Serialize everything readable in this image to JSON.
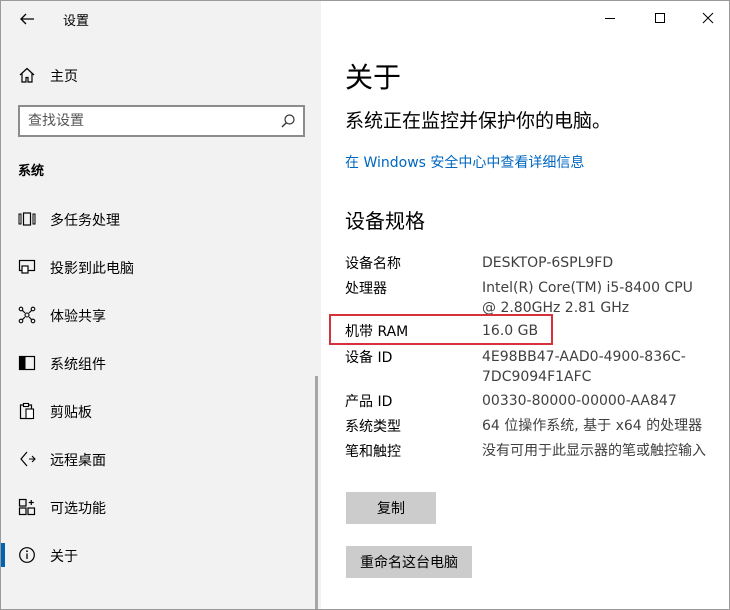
{
  "window": {
    "title": "设置"
  },
  "sidebar": {
    "home_label": "主页",
    "search_placeholder": "查找设置",
    "section_label": "系统",
    "items": [
      {
        "label": "多任务处理",
        "icon": "multitasking-icon"
      },
      {
        "label": "投影到此电脑",
        "icon": "project-icon"
      },
      {
        "label": "体验共享",
        "icon": "shared-experiences-icon"
      },
      {
        "label": "系统组件",
        "icon": "system-components-icon"
      },
      {
        "label": "剪贴板",
        "icon": "clipboard-icon"
      },
      {
        "label": "远程桌面",
        "icon": "remote-desktop-icon"
      },
      {
        "label": "可选功能",
        "icon": "optional-features-icon"
      },
      {
        "label": "关于",
        "icon": "info-icon",
        "selected": true
      }
    ]
  },
  "main": {
    "title": "关于",
    "subtitle": "系统正在监控并保护你的电脑。",
    "link": "在 Windows 安全中心中查看详细信息",
    "spec_title": "设备规格",
    "specs": [
      {
        "key": "设备名称",
        "value": "DESKTOP-6SPL9FD"
      },
      {
        "key": "处理器",
        "value": "Intel(R) Core(TM) i5-8400 CPU @ 2.80GHz   2.81 GHz"
      },
      {
        "key": "机带 RAM",
        "value": "16.0 GB"
      },
      {
        "key": "设备 ID",
        "value": "4E98BB47-AAD0-4900-836C-7DC9094F1AFC"
      },
      {
        "key": "产品 ID",
        "value": "00330-80000-00000-AA847"
      },
      {
        "key": "系统类型",
        "value": "64 位操作系统, 基于 x64 的处理器"
      },
      {
        "key": "笔和触控",
        "value": "没有可用于此显示器的笔或触控输入"
      }
    ],
    "copy_button": "复制",
    "rename_button": "重命名这台电脑"
  },
  "colors": {
    "accent": "#0063b1",
    "link": "#0067c0",
    "highlight_border": "#d6323c",
    "button_bg": "#cccccc",
    "sidebar_bg": "#f2f2f2"
  }
}
